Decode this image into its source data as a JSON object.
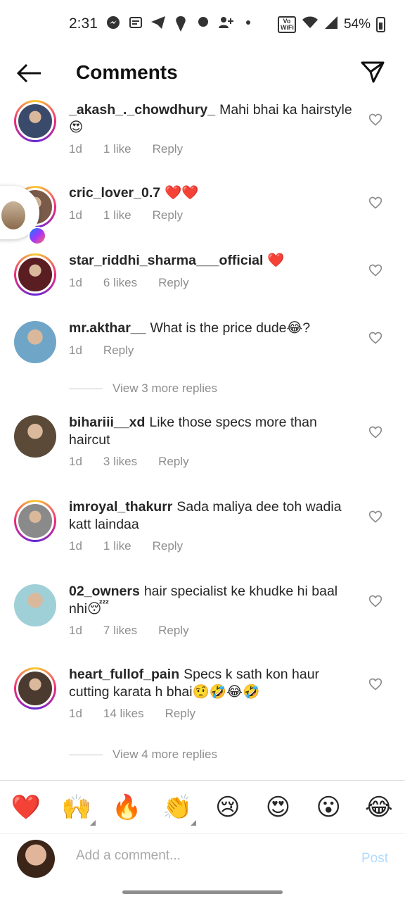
{
  "status_bar": {
    "time": "2:31",
    "battery": "54%",
    "icons_left": [
      "messenger-icon",
      "news-icon",
      "telegram-icon",
      "swiggy-icon",
      "app-icon",
      "add-user-icon",
      "dot-icon"
    ],
    "network_label": "Vo WiFi"
  },
  "header": {
    "title": "Comments"
  },
  "comments": [
    {
      "user": "_akash_._chowdhury_",
      "text": "Mahi bhai ka hairstyle 😍",
      "time": "1d",
      "likes": "1 like",
      "reply": "Reply",
      "ring": true,
      "avatar_color": "#3a4a6b"
    },
    {
      "user": "cric_lover_0.7",
      "text": "❤️❤️",
      "time": "1d",
      "likes": "1 like",
      "reply": "Reply",
      "ring": true,
      "avatar_color": "#7a5a48"
    },
    {
      "user": "star_riddhi_sharma___official",
      "text": "❤️",
      "time": "1d",
      "likes": "6 likes",
      "reply": "Reply",
      "ring": true,
      "avatar_color": "#5a1d22"
    },
    {
      "user": "mr.akthar__",
      "text": "What is the price dude😂?",
      "time": "1d",
      "likes": "",
      "reply": "Reply",
      "ring": false,
      "avatar_color": "#6fa6c8"
    },
    {
      "user": "bihariii__xd",
      "text": "Like those specs more than haircut",
      "time": "1d",
      "likes": "3 likes",
      "reply": "Reply",
      "ring": false,
      "avatar_color": "#5b4a38"
    },
    {
      "user": "imroyal_thakurr",
      "text": "Sada maliya dee toh wadia katt laindaa",
      "time": "1d",
      "likes": "1 like",
      "reply": "Reply",
      "ring": true,
      "avatar_color": "#8a8a8a"
    },
    {
      "user": "02_owners",
      "text": "hair specialist ke khudke hi baal nhi😴",
      "time": "1d",
      "likes": "7 likes",
      "reply": "Reply",
      "ring": false,
      "avatar_color": "#9fd0d8"
    },
    {
      "user": "heart_fullof_pain",
      "text": "Specs k sath kon haur cutting karata h bhai🤨🤣😂🤣",
      "time": "1d",
      "likes": "14 likes",
      "reply": "Reply",
      "ring": true,
      "avatar_color": "#4a3a30"
    }
  ],
  "view_more": [
    "View 3 more replies",
    "View 4 more replies"
  ],
  "emoji_bar": [
    "❤️",
    "🙌",
    "🔥",
    "👏",
    "😢",
    "😍",
    "😮",
    "😂"
  ],
  "input": {
    "placeholder": "Add a comment...",
    "post": "Post"
  }
}
